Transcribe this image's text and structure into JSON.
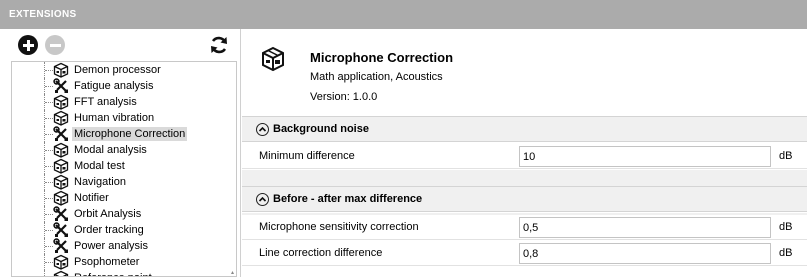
{
  "window": {
    "title": "EXTENSIONS"
  },
  "toolbar": {
    "add_icon": "add-circle-icon",
    "remove_icon": "remove-circle-icon",
    "refresh_icon": "refresh-icon"
  },
  "tree": {
    "items": [
      {
        "label": "Demon processor",
        "icon": "package-icon"
      },
      {
        "label": "Fatigue analysis",
        "icon": "tools-icon"
      },
      {
        "label": "FFT analysis",
        "icon": "package-icon"
      },
      {
        "label": "Human vibration",
        "icon": "package-icon"
      },
      {
        "label": "Microphone Correction",
        "icon": "tools-icon",
        "selected": true
      },
      {
        "label": "Modal analysis",
        "icon": "package-icon"
      },
      {
        "label": "Modal test",
        "icon": "package-icon"
      },
      {
        "label": "Navigation",
        "icon": "package-icon"
      },
      {
        "label": "Notifier",
        "icon": "package-icon"
      },
      {
        "label": "Orbit Analysis",
        "icon": "tools-icon"
      },
      {
        "label": "Order tracking",
        "icon": "tools-icon"
      },
      {
        "label": "Power analysis",
        "icon": "tools-icon"
      },
      {
        "label": "Psophometer",
        "icon": "package-icon"
      },
      {
        "label": "Reference point",
        "icon": "package-icon"
      }
    ]
  },
  "details": {
    "title": "Microphone Correction",
    "category": "Math application, Acoustics",
    "version": "Version: 1.0.0",
    "icon": "package-icon"
  },
  "sections": [
    {
      "title": "Background noise",
      "params": [
        {
          "label": "Minimum difference",
          "value": "10",
          "unit": "dB"
        }
      ]
    },
    {
      "title": "Before - after max difference",
      "params": [
        {
          "label": "Microphone sensitivity correction",
          "value": "0,5",
          "unit": "dB"
        },
        {
          "label": "Line correction difference",
          "value": "0,8",
          "unit": "dB"
        }
      ]
    }
  ],
  "colors": {
    "titlebar": "#ababab",
    "section_header": "#f0f0f0",
    "selection": "#dadada"
  }
}
